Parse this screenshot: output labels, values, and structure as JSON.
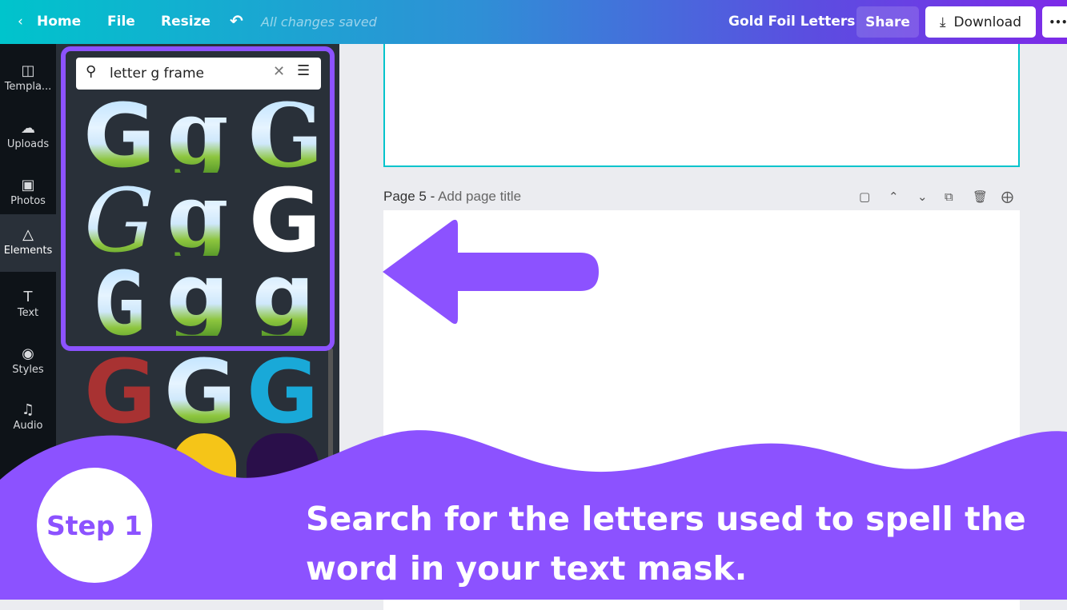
{
  "topbar": {
    "home": "Home",
    "file": "File",
    "resize": "Resize",
    "status": "All changes saved",
    "title": "Gold Foil Letters",
    "share": "Share",
    "download": "Download",
    "more": "•••"
  },
  "nav": [
    {
      "label": "Templa...",
      "icon": "template-icon"
    },
    {
      "label": "Uploads",
      "icon": "upload-icon"
    },
    {
      "label": "Photos",
      "icon": "photo-icon"
    },
    {
      "label": "Elements",
      "icon": "elements-icon"
    },
    {
      "label": "Text",
      "icon": "text-icon"
    },
    {
      "label": "Styles",
      "icon": "palette-icon"
    },
    {
      "label": "Audio",
      "icon": "music-icon"
    }
  ],
  "search": {
    "value": "letter g frame"
  },
  "tiles": [
    "G",
    "g",
    "G",
    "G",
    "g",
    "G",
    "G",
    "g",
    "g"
  ],
  "more_tiles": [
    "G",
    "G",
    "G"
  ],
  "page": {
    "label": "Page 5 - ",
    "placeholder": "Add page title"
  },
  "overlay": {
    "step": "Step 1",
    "caption": "Search for the letters used to spell the word in your text mask.",
    "accent": "#8c52ff"
  }
}
